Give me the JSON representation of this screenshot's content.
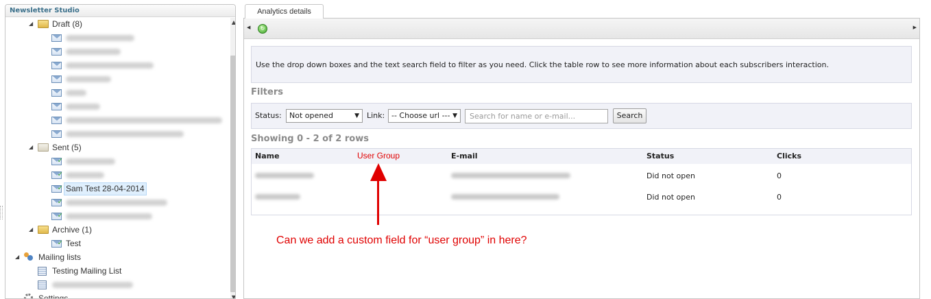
{
  "left_panel": {
    "title": "Newsletter Studio",
    "tree": {
      "draft": {
        "label": "Draft (8)",
        "items_blurred": 8
      },
      "sent": {
        "label": "Sent (5)",
        "selected_item": "Sam Test 28-04-2014"
      },
      "archive": {
        "label": "Archive (1)",
        "items": [
          "Test"
        ]
      },
      "mailing_lists": {
        "label": "Mailing lists",
        "items": [
          "Testing Mailing List"
        ]
      },
      "settings": {
        "label": "Settings"
      }
    }
  },
  "right_panel": {
    "tab": "Analytics details",
    "info_text": "Use the drop down boxes and the text search field to filter as you need. Click the table row to see more information about each subscribers interaction.",
    "filters_title": "Filters",
    "status_label": "Status:",
    "status_value": "Not opened",
    "link_label": "Link:",
    "link_value": "-- Choose url ---",
    "search_placeholder": "Search for name or e-mail...",
    "search_button": "Search",
    "showing": "Showing 0 - 2 of 2 rows",
    "table": {
      "headers": {
        "name": "Name",
        "user_group": "User Group",
        "email": "E-mail",
        "status": "Status",
        "clicks": "Clicks"
      },
      "rows": [
        {
          "status": "Did not open",
          "clicks": "0"
        },
        {
          "status": "Did not open",
          "clicks": "0"
        }
      ]
    }
  },
  "annotation": {
    "text": "Can we add a custom field for “user group” in here?",
    "color": "#e00000"
  }
}
